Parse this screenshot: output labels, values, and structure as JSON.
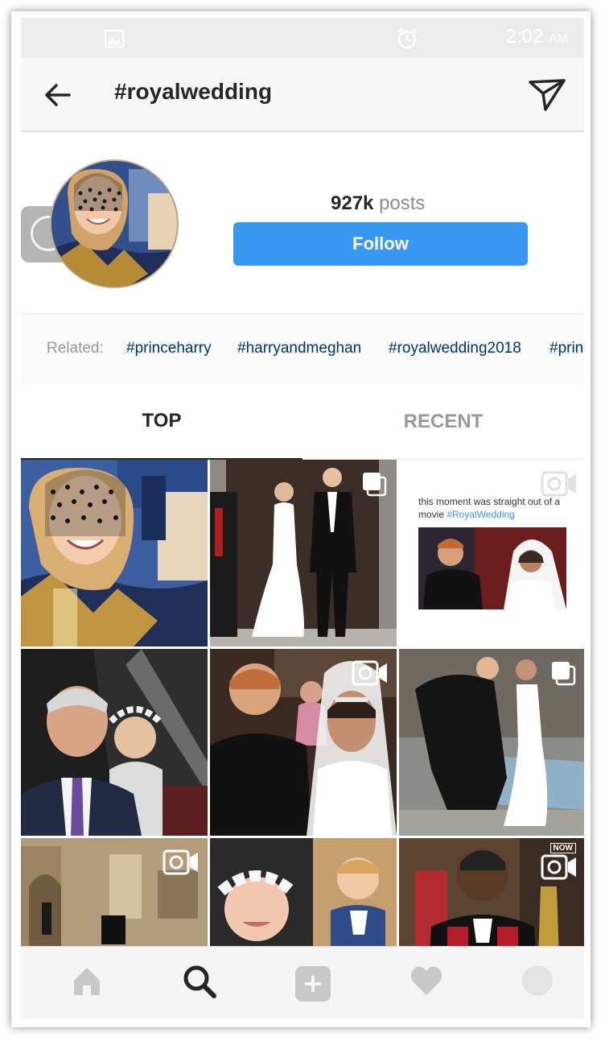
{
  "status": {
    "time": "2:02",
    "ampm": "AM",
    "icons": [
      "image-icon",
      "alarm-icon"
    ]
  },
  "header": {
    "title": "#royalwedding",
    "back_icon": "arrow-left-icon",
    "share_icon": "paper-plane-icon"
  },
  "profile": {
    "post_count": "927k",
    "post_label": "posts",
    "follow_label": "Follow"
  },
  "related": {
    "label": "Related:",
    "tags": [
      "#princeharry",
      "#harryandmeghan",
      "#royalwedding2018",
      "#prin"
    ]
  },
  "tabs": {
    "top": "TOP",
    "recent": "RECENT"
  },
  "grid": {
    "post3_caption_line1": "this moment was straight out of a",
    "post3_caption_prefix": "movie ",
    "post3_caption_tag": "#RoyalWedding",
    "post9_badge": "NOW"
  },
  "bottom_nav": {
    "icons": [
      "home-icon",
      "search-icon",
      "add-post-icon",
      "heart-icon",
      "profile-icon"
    ]
  },
  "colors": {
    "accent": "#3897f0",
    "tag_link": "#003569",
    "muted": "#999999"
  }
}
